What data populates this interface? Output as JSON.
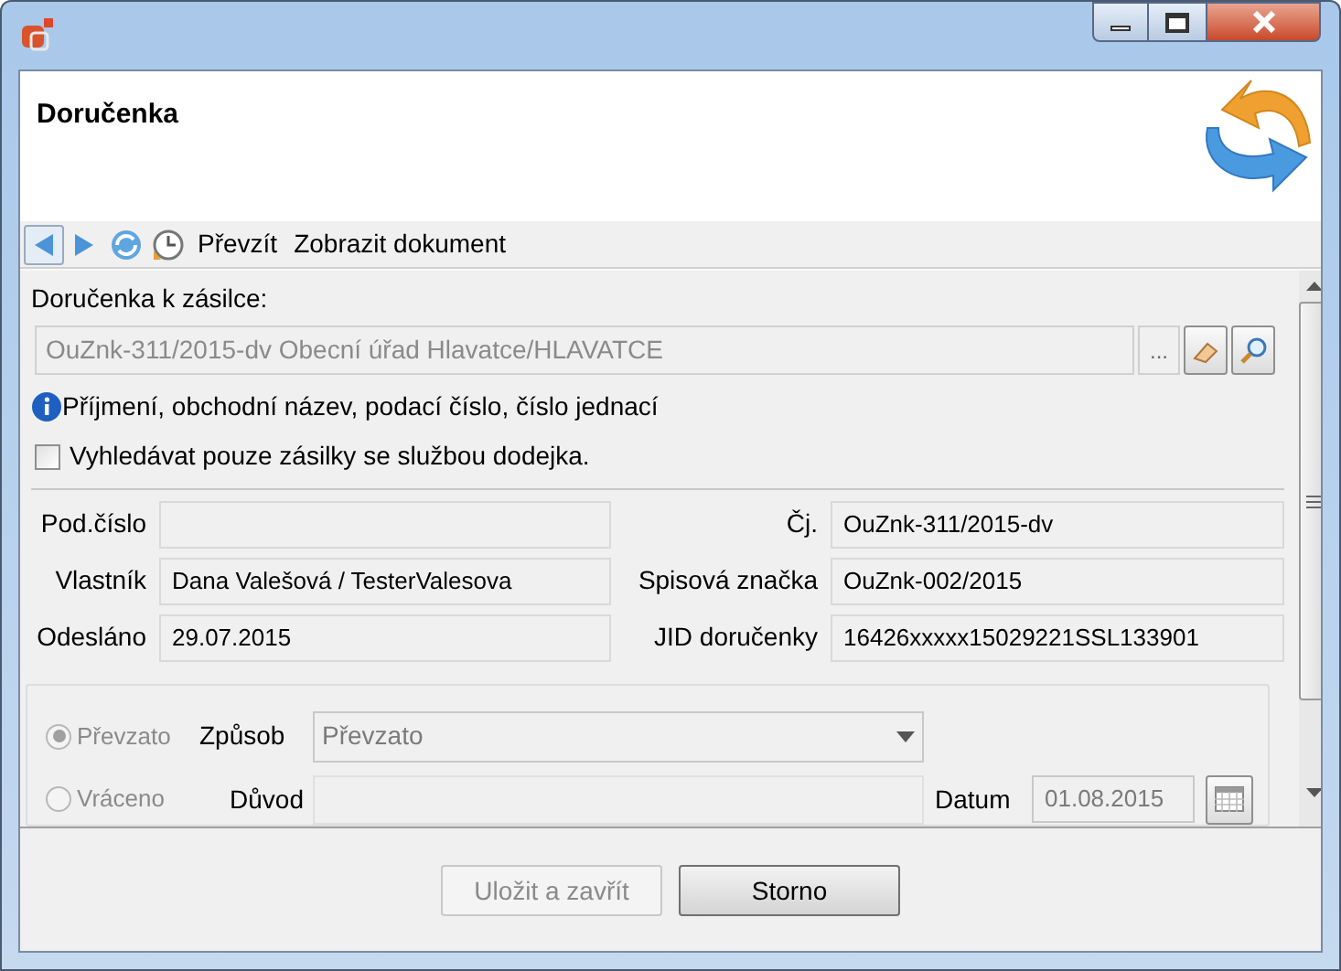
{
  "header": {
    "title": "Doručenka"
  },
  "toolbar": {
    "actions": [
      {
        "label": "Převzít"
      },
      {
        "label": "Zobrazit dokument"
      }
    ]
  },
  "search": {
    "label": "Doručenka k zásilce:",
    "value": "OuZnk-311/2015-dv Obecní úřad Hlavatce/HLAVATCE",
    "browse_button": "...",
    "disabled": true
  },
  "hint": "Příjmení, obchodní název, podací číslo, číslo jednací",
  "filter_checkbox": {
    "label": "Vyhledávat pouze zásilky se službou dodejka.",
    "checked": false
  },
  "fields": [
    {
      "label": "Pod.číslo"
    },
    {
      "label": "Čj.",
      "value": "OuZnk-311/2015-dv"
    },
    {
      "label": "Vlastník",
      "value": "Dana Valešová / TesterValesova"
    },
    {
      "label": "Spisová značka",
      "value": "OuZnk-002/2015"
    },
    {
      "label": "Odesláno",
      "value": "29.07.2015"
    },
    {
      "label": "JID doručenky",
      "value": "16426xxxxx15029221SSL133901"
    }
  ],
  "delivery": {
    "options": [
      {
        "label": "Převzato",
        "selected": true,
        "disabled": true
      },
      {
        "label": "Vráceno",
        "selected": false,
        "disabled": true
      }
    ],
    "method": {
      "label": "Způsob",
      "value": "Převzato"
    },
    "reason": {
      "label": "Důvod"
    },
    "date": {
      "label": "Datum",
      "value": "01.08.2015",
      "disabled": true
    }
  },
  "buttons": [
    {
      "label": "Uložit a zavřít",
      "disabled": true
    },
    {
      "label": "Storno",
      "disabled": false
    }
  ]
}
